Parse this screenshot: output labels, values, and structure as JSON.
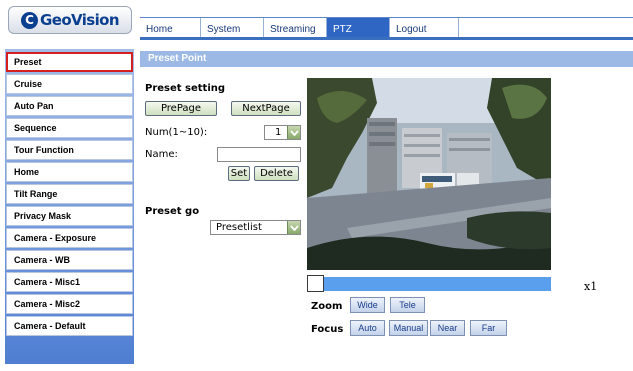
{
  "brand": {
    "logo_letter": "C",
    "logo_text": "GeoVision"
  },
  "topnav": {
    "tabs": [
      {
        "label": "Home",
        "active": false
      },
      {
        "label": "System",
        "active": false
      },
      {
        "label": "Streaming",
        "active": false
      },
      {
        "label": "PTZ",
        "active": true
      },
      {
        "label": "Logout",
        "active": false
      }
    ]
  },
  "sidebar": {
    "items": [
      {
        "label": "Preset",
        "selected": true
      },
      {
        "label": "Cruise"
      },
      {
        "label": "Auto Pan"
      },
      {
        "label": "Sequence"
      },
      {
        "label": "Tour Function"
      },
      {
        "label": "Home"
      },
      {
        "label": "Tilt Range"
      },
      {
        "label": "Privacy Mask"
      },
      {
        "label": "Camera - Exposure"
      },
      {
        "label": "Camera - WB"
      },
      {
        "label": "Camera - Misc1"
      },
      {
        "label": "Camera - Misc2"
      },
      {
        "label": "Camera - Default"
      }
    ]
  },
  "main": {
    "section_title": "Preset Point",
    "preset_setting": {
      "heading": "Preset setting",
      "prepage_label": "PrePage",
      "nextpage_label": "NextPage",
      "num_label": "Num(1~10):",
      "num_value": "1",
      "name_label": "Name:",
      "name_value": "",
      "set_label": "Set",
      "delete_label": "Delete"
    },
    "preset_go": {
      "heading": "Preset go",
      "select_value": "Presetlist"
    },
    "zoom_readout": "x1",
    "zoom": {
      "label": "Zoom",
      "wide_label": "Wide",
      "tele_label": "Tele"
    },
    "focus": {
      "label": "Focus",
      "auto_label": "Auto",
      "manual_label": "Manual",
      "near_label": "Near",
      "far_label": "Far"
    }
  },
  "colors": {
    "nav_active": "#2f66c4",
    "section_bar": "#9cb9e6",
    "sidebar_gradient_top": "#a3bde9",
    "sidebar_gradient_bottom": "#4f7ed2",
    "selected_outline": "#d41f1f",
    "zoom_bar": "#5a9fee"
  },
  "icons": {
    "select_arrow": "chevron-down-icon"
  }
}
